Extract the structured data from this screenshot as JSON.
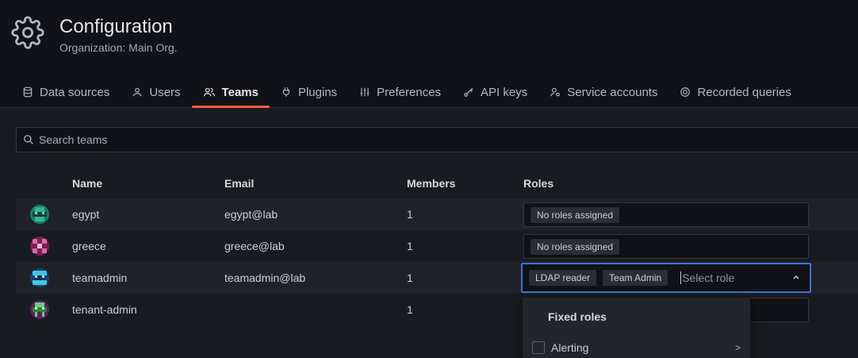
{
  "header": {
    "title": "Configuration",
    "subtitle": "Organization: Main Org."
  },
  "tabs": [
    {
      "label": "Data sources",
      "icon": "database-icon",
      "active": false
    },
    {
      "label": "Users",
      "icon": "user-icon",
      "active": false
    },
    {
      "label": "Teams",
      "icon": "users-icon",
      "active": true
    },
    {
      "label": "Plugins",
      "icon": "plug-icon",
      "active": false
    },
    {
      "label": "Preferences",
      "icon": "sliders-icon",
      "active": false
    },
    {
      "label": "API keys",
      "icon": "key-icon",
      "active": false
    },
    {
      "label": "Service accounts",
      "icon": "service-account-icon",
      "active": false
    },
    {
      "label": "Recorded queries",
      "icon": "record-icon",
      "active": false
    }
  ],
  "search": {
    "placeholder": "Search teams",
    "value": ""
  },
  "table": {
    "columns": [
      "Name",
      "Email",
      "Members",
      "Roles"
    ],
    "rows": [
      {
        "name": "egypt",
        "email": "egypt@lab",
        "members": "1",
        "roles": [
          "No roles assigned"
        ]
      },
      {
        "name": "greece",
        "email": "greece@lab",
        "members": "1",
        "roles": [
          "No roles assigned"
        ]
      },
      {
        "name": "teamadmin",
        "email": "teamadmin@lab",
        "members": "1",
        "roles": [
          "LDAP reader",
          "Team Admin"
        ]
      },
      {
        "name": "tenant-admin",
        "email": "",
        "members": "1",
        "roles": []
      }
    ]
  },
  "role_picker": {
    "placeholder": "Select role",
    "section": "Fixed roles",
    "items": [
      {
        "label": "Alerting",
        "arrow": ">"
      }
    ]
  },
  "colors": {
    "accent": "#f55f3e",
    "focus": "#3d71d9",
    "background": "#181b1f"
  }
}
